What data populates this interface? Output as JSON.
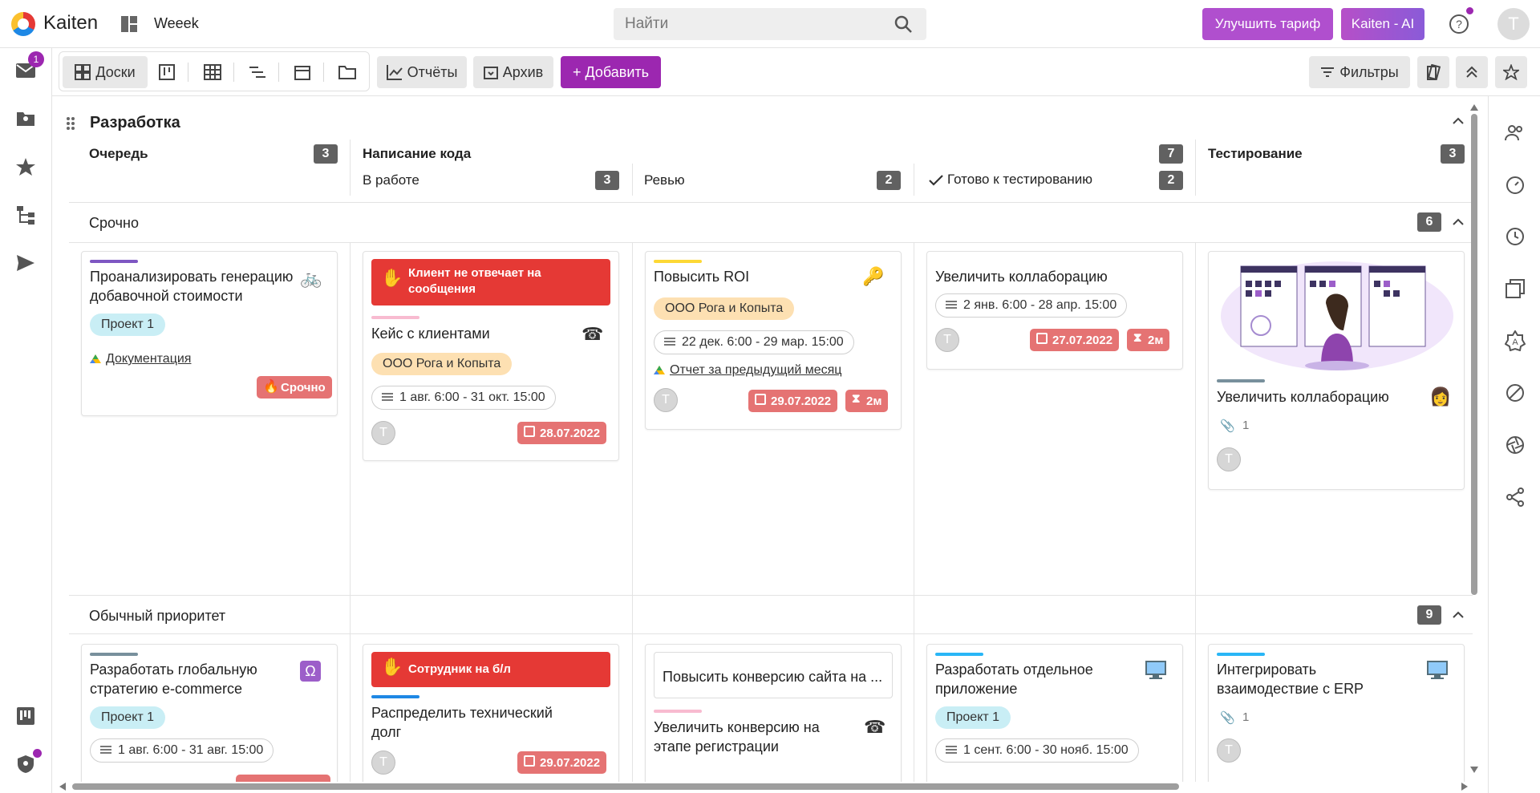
{
  "app": {
    "brand": "Kaiten",
    "workspace": "Weeek"
  },
  "search": {
    "placeholder": "Найти"
  },
  "header": {
    "upgrade_label": "Улучшить тариф",
    "ai_label": "Kaiten - AI",
    "avatar_letter": "T",
    "mail_badge": "1"
  },
  "toolbar": {
    "boards_label": "Доски",
    "reports_label": "Отчёты",
    "archive_label": "Архив",
    "add_label": "+ Добавить",
    "filters_label": "Фильтры"
  },
  "board": {
    "title": "Разработка",
    "columns": [
      {
        "name": "Очередь",
        "count": "3"
      },
      {
        "name": "Написание кода",
        "count": "7"
      },
      {
        "name": "Тестирование",
        "count": "3"
      }
    ],
    "subcolumns": [
      {
        "name": "В работе",
        "count": "3"
      },
      {
        "name": "Ревью",
        "count": "2"
      },
      {
        "name": "Готово к тестированию",
        "count": "2"
      }
    ],
    "lanes": [
      {
        "name": "Срочно",
        "count": "6"
      },
      {
        "name": "Обычный приоритет",
        "count": "9"
      }
    ]
  },
  "cards": {
    "c1": {
      "title": "Проанализировать генерацию добавочной стоимости",
      "tag": "Проект 1",
      "link": "Документация",
      "badge": "Срочно",
      "stripe": "#7e57c2",
      "icon": "bicycle"
    },
    "c2": {
      "banner": "Клиент не отвечает на сообщения",
      "title": "Кейс с клиентами",
      "tag": "ООО Рога и Копыта",
      "dates": "1 авг. 6:00 - 31 окт. 15:00",
      "due": "28.07.2022",
      "stripe": "#f8bbd0",
      "icon": "telephone",
      "avatar": "T"
    },
    "c3": {
      "title": "Повысить ROI",
      "tag": "ООО Рога и Копыта",
      "dates": "22 дек. 6:00 - 29 мар. 15:00",
      "link": "Отчет за предыдущий месяц",
      "due": "29.07.2022",
      "timer": "2м",
      "stripe": "#fdd835",
      "icon": "key",
      "avatar": "T"
    },
    "c4": {
      "title": "Увеличить коллаборацию",
      "dates": "2 янв. 6:00 - 28 апр. 15:00",
      "due": "27.07.2022",
      "timer": "2м",
      "avatar": "T"
    },
    "c5": {
      "title": "Увеличить коллаборацию",
      "attachments": "1",
      "stripe": "#78909c",
      "avatar": "T"
    },
    "c6": {
      "title": "Разработать глобальную стратегию e-commerce",
      "tag": "Проект 1",
      "dates": "1 авг. 6:00 - 31 авг. 15:00",
      "stripe": "#78909c",
      "icon": "omega"
    },
    "c7": {
      "banner": "Сотрудник на б/л",
      "title": "Распределить технический долг",
      "due": "29.07.2022",
      "stripe": "#1e88e5",
      "avatar": "T"
    },
    "c8": {
      "subtask": "Повысить конверсию сайта на ...",
      "title": "Увеличить конверсию на этапе регистрации",
      "stripe": "#f8bbd0",
      "icon": "telephone"
    },
    "c9": {
      "title": "Разработать отдельное приложение",
      "tag": "Проект 1",
      "dates": "1 сент. 6:00 - 30 нояб. 15:00",
      "stripe": "#29b6f6",
      "icon": "computer"
    },
    "c10": {
      "title": "Интегрировать взаимодествие с ERP",
      "attachments": "1",
      "stripe": "#29b6f6",
      "icon": "computer",
      "avatar": "T"
    }
  },
  "colors": {
    "accent": "#9c27b0",
    "danger": "#e53935",
    "due_pill": "#e57373",
    "count_badge": "#616161"
  }
}
